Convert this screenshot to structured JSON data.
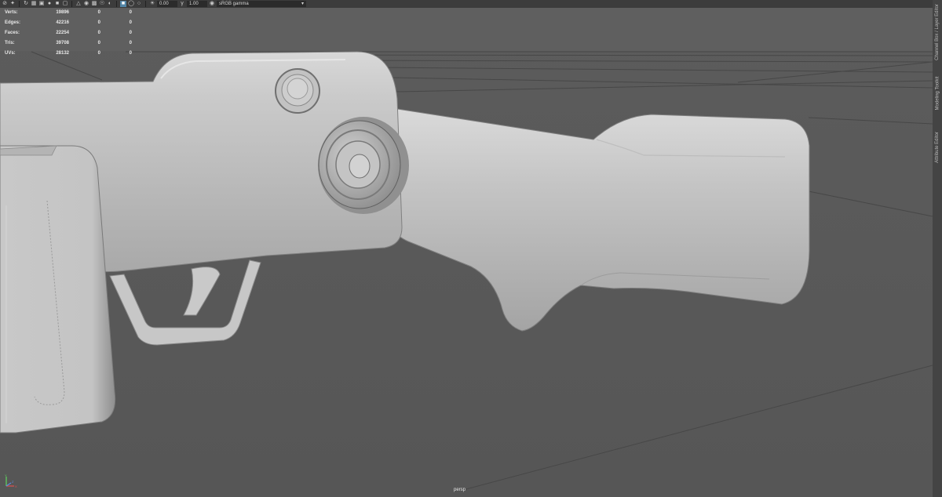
{
  "toolbar": {
    "icons": [
      "select-mode-icon",
      "move-icon",
      "rotate-icon",
      "grid-icon",
      "film-icon",
      "camera-icon",
      "lock-icon",
      "frame-icon",
      "bookmark-icon",
      "image-plane-icon",
      "wireframe-icon",
      "smooth-shade-icon",
      "textured-icon",
      "lights-icon",
      "shadows-icon",
      "ambient-occlusion-icon",
      "motion-blur-icon",
      "anti-alias-icon",
      "isolate-icon",
      "xray-icon",
      "xray-joints-icon",
      "backface-icon",
      "exposure-icon",
      "gamma-icon"
    ],
    "exposure_value": "0.00",
    "gamma_value": "1.00",
    "color_space": "sRGB gamma"
  },
  "hud": {
    "rows": [
      {
        "label": "Verts:",
        "value": "19896",
        "selected": "0",
        "components": "0"
      },
      {
        "label": "Edges:",
        "value": "42216",
        "selected": "0",
        "components": "0"
      },
      {
        "label": "Faces:",
        "value": "22254",
        "selected": "0",
        "components": "0"
      },
      {
        "label": "Tris:",
        "value": "39708",
        "selected": "0",
        "components": "0"
      },
      {
        "label": "UVs:",
        "value": "28132",
        "selected": "0",
        "components": "0"
      }
    ]
  },
  "camera_label": "persp",
  "side_tabs": [
    "Channel Box / Layer Editor",
    "Modeling Toolkit",
    "Attribute Editor"
  ],
  "axis": {
    "x_label": "X",
    "y_label": "Y",
    "z_label": "Z"
  }
}
